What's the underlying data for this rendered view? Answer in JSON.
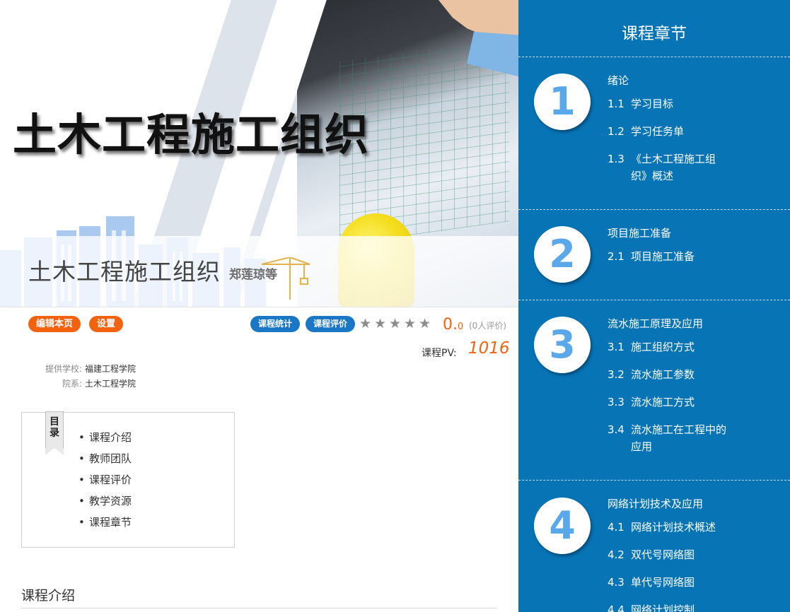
{
  "banner": {
    "title": "土木工程施工组织",
    "course_name": "土木工程施工组织",
    "author": "郑莲琼等"
  },
  "toolbar": {
    "edit_label": "编辑本页",
    "settings_label": "设置",
    "stats_label": "课程统计",
    "review_label": "课程评价",
    "rating_stars": 0,
    "rating_max": 5,
    "score_int": "0.",
    "score_dec": "0",
    "score_count": "(0人评价)",
    "pv_label": "课程PV:",
    "pv_value": "1016"
  },
  "meta": {
    "school_label": "提供学校:",
    "school_value": "福建工程学院",
    "dept_label": "院系:",
    "dept_value": "土木工程学院"
  },
  "toc": {
    "flag": "目录",
    "items": [
      "课程介绍",
      "教师团队",
      "课程评价",
      "教学资源",
      "课程章节"
    ]
  },
  "section": {
    "title": "课程介绍"
  },
  "chapters": {
    "title": "课程章节",
    "list": [
      {
        "number": "1",
        "title": "绪论",
        "items": [
          {
            "num": "1.1",
            "text": "学习目标"
          },
          {
            "num": "1.2",
            "text": "学习任务单"
          },
          {
            "num": "1.3",
            "text": "《土木工程施工组",
            "text2": "织》概述"
          }
        ]
      },
      {
        "number": "2",
        "title": "项目施工准备",
        "items": [
          {
            "num": "2.1",
            "text": "项目施工准备"
          }
        ]
      },
      {
        "number": "3",
        "title": "流水施工原理及应用",
        "items": [
          {
            "num": "3.1",
            "text": "施工组织方式"
          },
          {
            "num": "3.2",
            "text": "流水施工参数"
          },
          {
            "num": "3.3",
            "text": "流水施工方式"
          },
          {
            "num": "3.4",
            "text": "流水施工在工程中的",
            "text2": "应用"
          }
        ]
      },
      {
        "number": "4",
        "title": "网络计划技术及应用",
        "items": [
          {
            "num": "4.1",
            "text": "网络计划技术概述"
          },
          {
            "num": "4.2",
            "text": "双代号网络图"
          },
          {
            "num": "4.3",
            "text": "单代号网络图"
          },
          {
            "num": "4.4",
            "text": "网络计划控制"
          }
        ]
      }
    ]
  },
  "colors": {
    "accent_orange": "#f2620f",
    "accent_blue": "#1a77c6",
    "panel_blue": "#0774b6",
    "circle_number": "#5aa8ea"
  }
}
